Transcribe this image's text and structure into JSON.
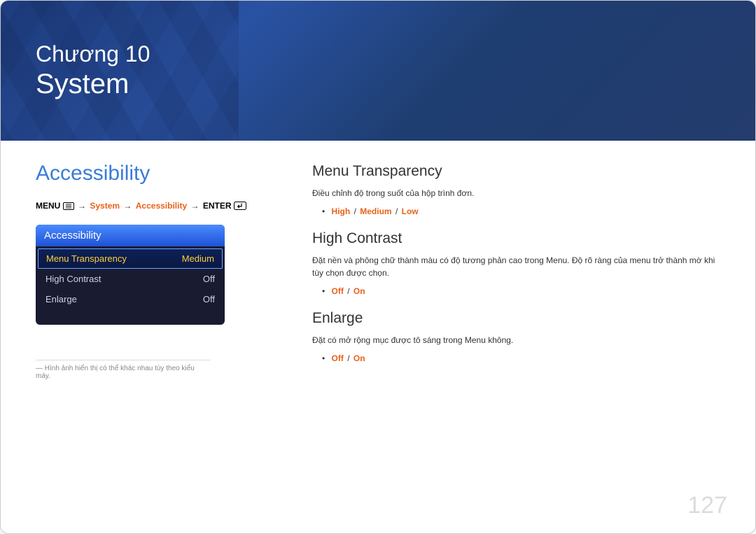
{
  "header": {
    "chapter_label": "Chương 10",
    "chapter_title": "System"
  },
  "left": {
    "section_title": "Accessibility",
    "breadcrumb": {
      "menu_label": "MENU",
      "step1": "System",
      "step2": "Accessibility",
      "enter_label": "ENTER"
    },
    "menu_panel": {
      "title": "Accessibility",
      "rows": [
        {
          "label": "Menu Transparency",
          "value": "Medium",
          "selected": true
        },
        {
          "label": "High Contrast",
          "value": "Off",
          "selected": false
        },
        {
          "label": "Enlarge",
          "value": "Off",
          "selected": false
        }
      ]
    },
    "footnote": "― Hình ảnh hiển thị có thể khác nhau tùy theo kiểu máy."
  },
  "right": {
    "sections": [
      {
        "title": "Menu Transparency",
        "desc": "Điều chỉnh độ trong suốt của hộp trình đơn.",
        "options": [
          "High",
          "Medium",
          "Low"
        ]
      },
      {
        "title": "High Contrast",
        "desc": "Đặt nền và phông chữ thành màu có độ tương phản cao trong Menu. Độ rõ ràng của menu trở thành mờ khi tùy chọn được chọn.",
        "options": [
          "Off",
          "On"
        ]
      },
      {
        "title": "Enlarge",
        "desc": "Đặt có mở rộng mục được tô sáng trong Menu không.",
        "options": [
          "Off",
          "On"
        ]
      }
    ]
  },
  "page_number": "127"
}
